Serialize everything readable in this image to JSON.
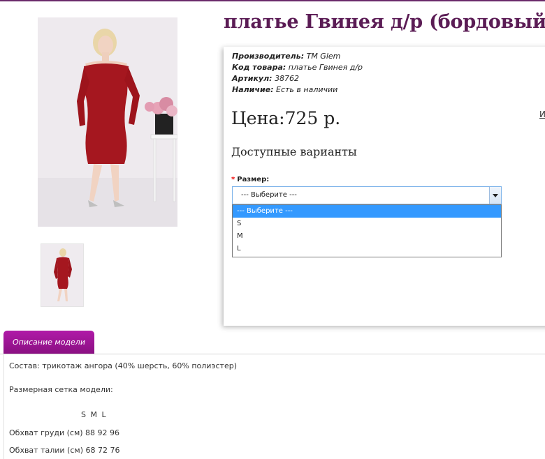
{
  "product": {
    "title": "платье Гвинея д/р (бордовый)",
    "meta": [
      {
        "label": "Производитель:",
        "value": "ТМ Glem"
      },
      {
        "label": "Код товара:",
        "value": "платье Гвинея д/р"
      },
      {
        "label": "Артикул:",
        "value": "38762"
      },
      {
        "label": "Наличие:",
        "value": "Есть в наличии"
      }
    ],
    "price": "Цена:725 р.",
    "side_link": "И",
    "variants_heading": "Доступные варианты",
    "size_label": "Размер:",
    "required_mark": "*",
    "size_select": {
      "value": "--- Выберите ---",
      "options": [
        "--- Выберите ---",
        "S",
        "M",
        "L"
      ]
    }
  },
  "tabs": [
    {
      "label": "Описание модели",
      "active": true
    }
  ],
  "description": {
    "composition": "Состав: трикотаж ангора (40% шерсть, 60% полиэстер)",
    "size_grid_title": "Размерная сетка модели:",
    "size_header": "S  M  L",
    "rows": [
      "Обхват груди (см) 88 92 96",
      "Обхват талии (см) 68 72 76"
    ]
  },
  "colors": {
    "title": "#5b1c55",
    "tab": "#9c1596",
    "dress": "#a5171f",
    "selected_option": "#3399ff"
  }
}
